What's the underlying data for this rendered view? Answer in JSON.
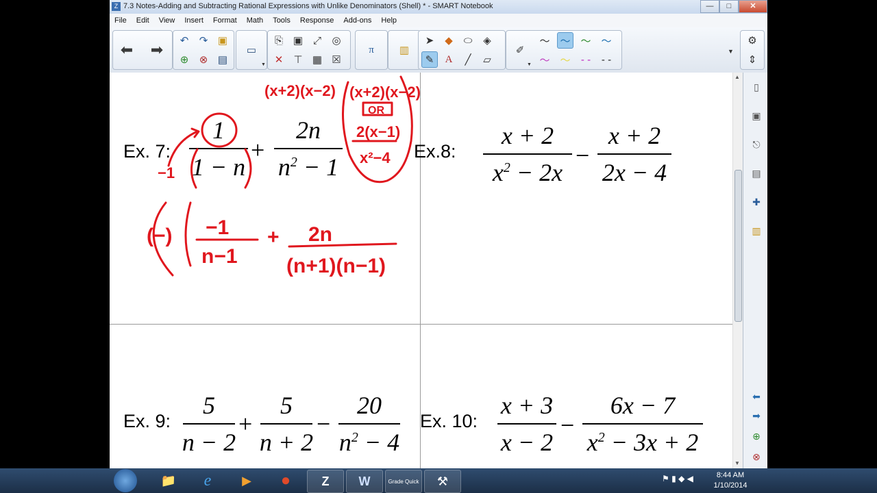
{
  "window": {
    "title": "7.3 Notes-Adding and Subtracting Rational Expressions with Unlike Denominators (Shell) * - SMART Notebook",
    "app_icon": "Z",
    "minimize": "—",
    "maximize": "□",
    "close": "✕"
  },
  "menu": [
    "File",
    "Edit",
    "View",
    "Insert",
    "Format",
    "Math",
    "Tools",
    "Response",
    "Add-ons",
    "Help"
  ],
  "colors": {
    "ink": "#e0171e",
    "accent": "#9ccbee",
    "titlebar": "#c9d9ee"
  },
  "examples": {
    "ex7": {
      "label": "Ex. 7:",
      "num1": "1",
      "den1": "1 − n",
      "op": "+",
      "num2": "2n",
      "den2_base": "n",
      "den2_exp": "2",
      "den2_rest": " − 1"
    },
    "ex8": {
      "label": "Ex.8:",
      "num1": "x + 2",
      "den1_base": "x",
      "den1_exp": "2",
      "den1_rest": " − 2x",
      "op": "−",
      "num2": "x + 2",
      "den2": "2x − 4"
    },
    "ex9": {
      "label": "Ex. 9:",
      "num1": "5",
      "den1": "n − 2",
      "op1": "+",
      "num2": "5",
      "den2": "n + 2",
      "op2": "−",
      "num3": "20",
      "den3_base": "n",
      "den3_exp": "2",
      "den3_rest": " − 4"
    },
    "ex10": {
      "label": "Ex. 10:",
      "num1": "x + 3",
      "den1": "x − 2",
      "op": "−",
      "num2": "6x − 7",
      "den2_base": "x",
      "den2_exp": "2",
      "den2_rest": " − 3x + 2"
    }
  },
  "handwriting": {
    "top_left": "(x+2)(x−2)",
    "top_right": "(x+2)(x−2)",
    "or": "OR",
    "alt_num": "2(x−1)",
    "alt_den": "x²−4",
    "neg1": "−1",
    "factor": "(−)",
    "frac1_num": "−1",
    "frac1_den": "n−1",
    "plus": "+",
    "frac2_num": "2n",
    "frac2_den": "(n+1)(n−1)"
  },
  "taskbar": {
    "apps": [
      {
        "name": "file-explorer",
        "glyph": "📁"
      },
      {
        "name": "internet-explorer",
        "glyph": "e"
      },
      {
        "name": "media-player",
        "glyph": "▶"
      },
      {
        "name": "chrome",
        "glyph": "●"
      },
      {
        "name": "smart-notebook",
        "glyph": "Z"
      },
      {
        "name": "word",
        "glyph": "W"
      },
      {
        "name": "grade-quick",
        "glyph": "Grade Quick"
      },
      {
        "name": "utility",
        "glyph": "⚒"
      }
    ],
    "time": "8:44 AM",
    "date": "1/10/2014"
  }
}
